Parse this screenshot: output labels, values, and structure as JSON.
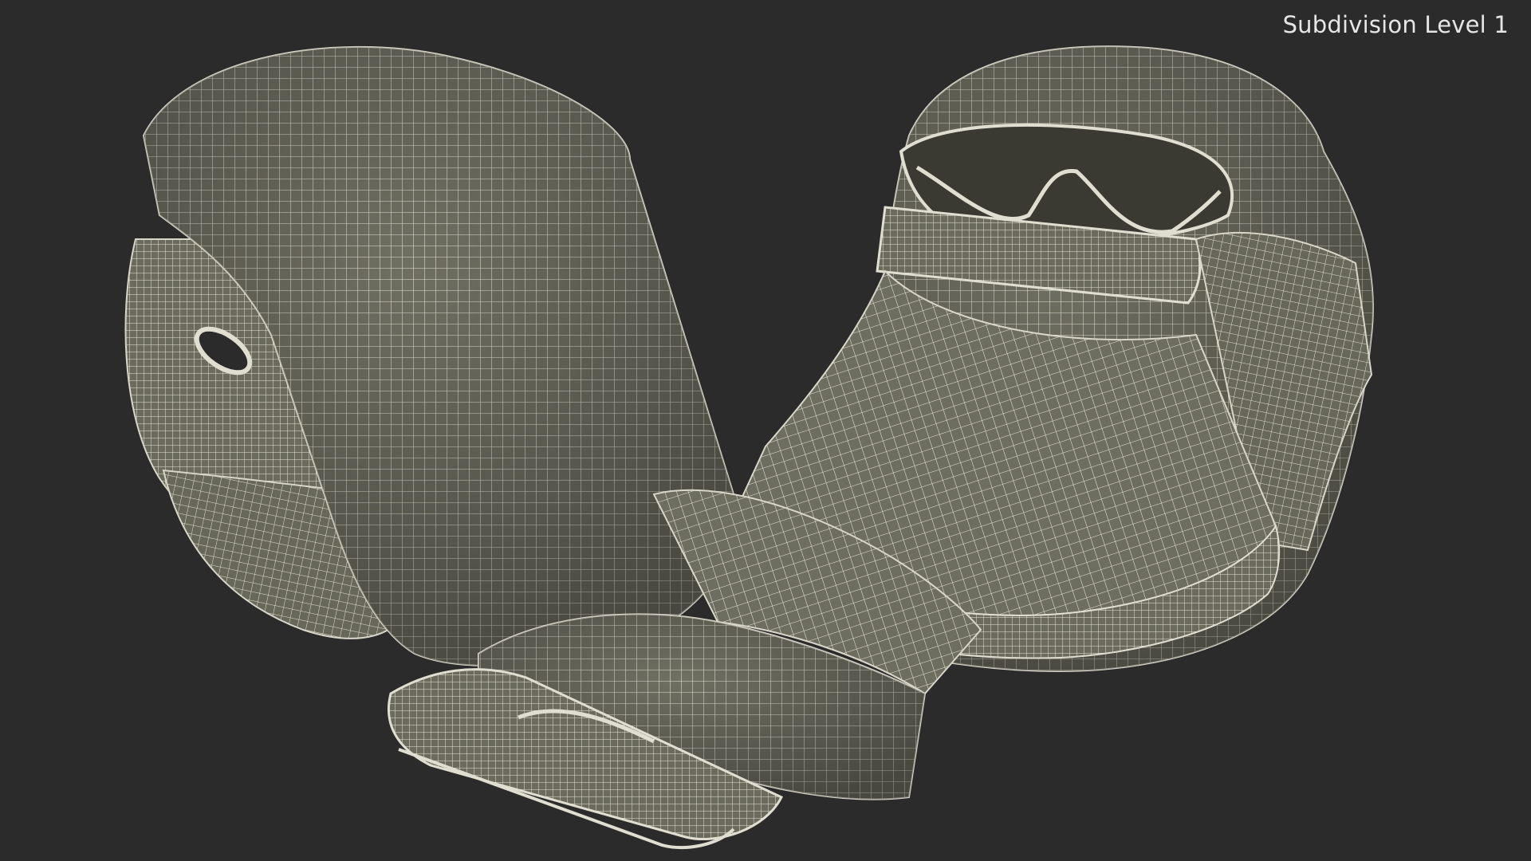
{
  "viewport": {
    "overlay_label": "Subdivision Level 1",
    "background_color": "#2b2b2b",
    "mesh_fill_color": "#6f6f62",
    "mesh_wire_color": "#e8e6da"
  }
}
